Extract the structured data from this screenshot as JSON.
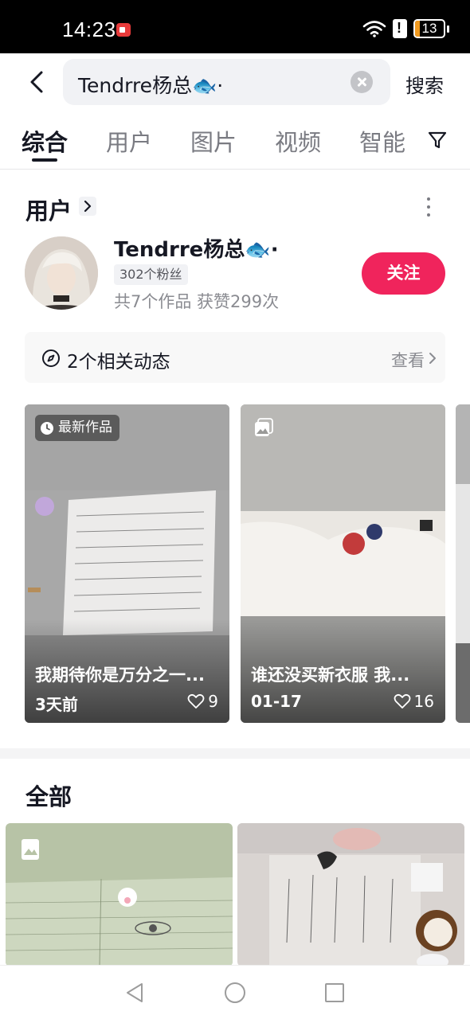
{
  "status_bar": {
    "time": "14:23",
    "battery": "13"
  },
  "search": {
    "query": "Tendrre杨总🐟·",
    "search_label": "搜索"
  },
  "tabs": [
    {
      "label": "综合"
    },
    {
      "label": "用户"
    },
    {
      "label": "图片"
    },
    {
      "label": "视频"
    },
    {
      "label": "智能"
    }
  ],
  "users_section": {
    "title": "用户",
    "user": {
      "name": "Tendrre杨总🐟·",
      "fans": "302个粉丝",
      "stats": "共7个作品 获赞299次",
      "follow_label": "关注"
    },
    "related": {
      "text": "2个相关动态",
      "view_label": "查看"
    }
  },
  "works": [
    {
      "badge": "最新作品",
      "title": "我期待你是万分之一...",
      "date": "3天前",
      "likes": "9"
    },
    {
      "title": "谁还没买新衣服  我...",
      "date": "01-17",
      "likes": "16"
    }
  ],
  "all_section": {
    "title": "全部"
  },
  "colors": {
    "accent": "#f0245c",
    "battery": "#f29b1f",
    "text": "#161823",
    "muted": "#8a8b91"
  }
}
